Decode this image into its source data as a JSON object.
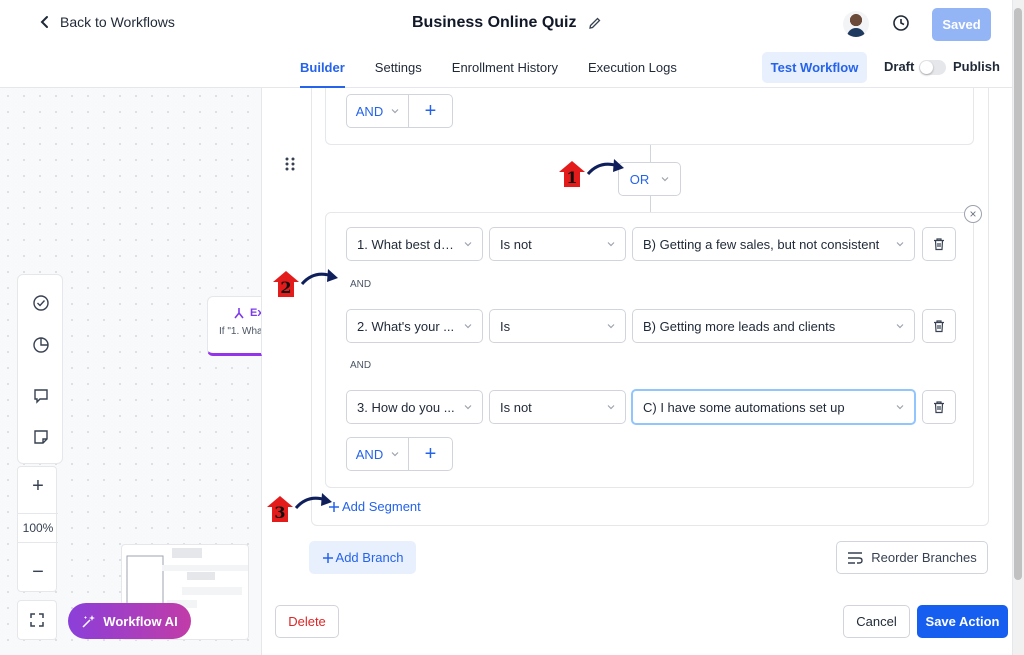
{
  "header": {
    "back_label": "Back to Workflows",
    "workflow_title": "Business Online Quiz",
    "saved_label": "Saved"
  },
  "tabs": [
    {
      "label": "Builder",
      "active": true
    },
    {
      "label": "Settings",
      "active": false
    },
    {
      "label": "Enrollment History",
      "active": false
    },
    {
      "label": "Execution Logs",
      "active": false
    }
  ],
  "test_workflow_label": "Test Workflow",
  "draft_label": "Draft",
  "publish_label": "Publish",
  "canvas": {
    "zoom_level": "100%",
    "node_title": "Ex",
    "node_subtitle": "If \"1. Wha",
    "ai_button_label": "Workflow AI"
  },
  "segment1": {
    "and_label": "AND",
    "plus_label": "+"
  },
  "or_label": "OR",
  "segment2": {
    "conditions": [
      {
        "field": "1. What best de...",
        "operator": "Is not",
        "value": "B) Getting a few sales, but not consistent"
      },
      {
        "field": "2. What's your ...",
        "operator": "Is",
        "value": "B) Getting more leads and clients"
      },
      {
        "field": "3. How do you ...",
        "operator": "Is not",
        "value": "C) I have some automations set up"
      }
    ],
    "connector_label": "AND",
    "and_label": "AND",
    "plus_label": "+"
  },
  "add_segment_label": "Add Segment",
  "add_branch_label": "Add Branch",
  "reorder_branches_label": "Reorder Branches",
  "footer": {
    "delete_label": "Delete",
    "cancel_label": "Cancel",
    "save_label": "Save Action"
  },
  "annotations": [
    "1",
    "2",
    "3"
  ],
  "colors": {
    "primary": "#155eef",
    "accent_blue": "#2563eb",
    "danger": "#dc2626",
    "ai_gradient_start": "#8b3fd9",
    "ai_gradient_end": "#c13ca8",
    "marker_red": "#e31b1b",
    "arrow_navy": "#0f1f5c"
  }
}
